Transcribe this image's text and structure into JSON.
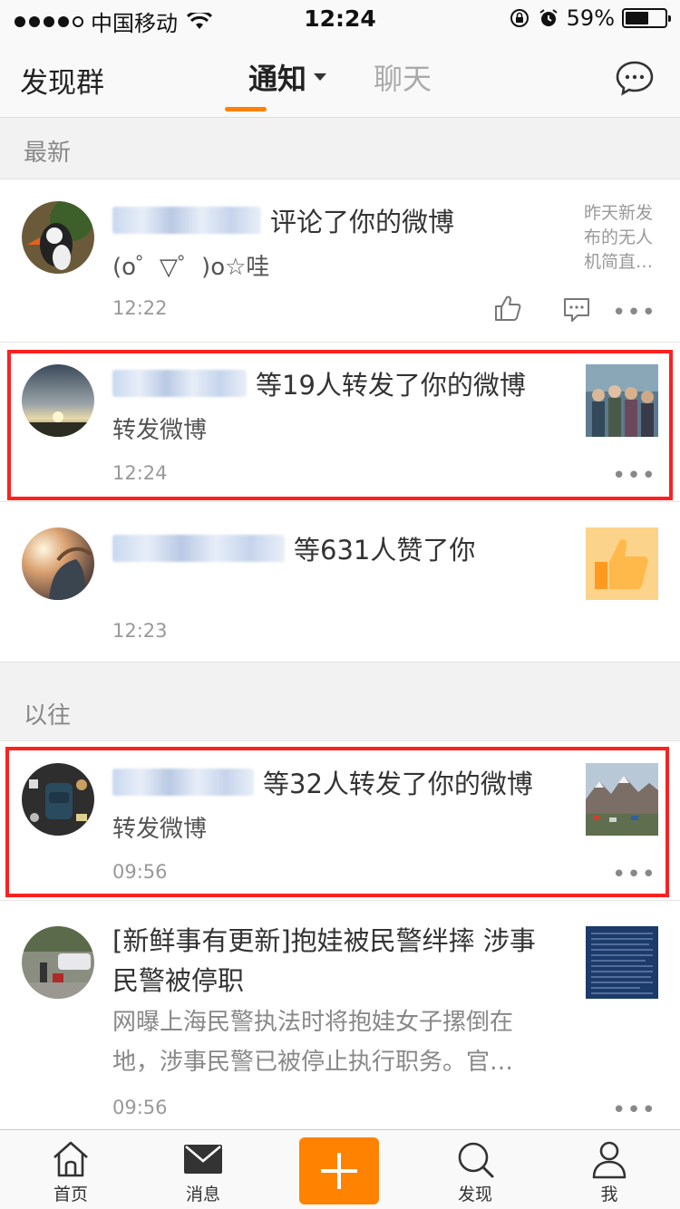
{
  "status_bar": {
    "carrier": "中国移动",
    "time": "12:24",
    "battery": "59%",
    "battery_level": 0.59
  },
  "nav": {
    "left_label": "发现群",
    "tabs": [
      {
        "label": "通知"
      },
      {
        "label": "聊天"
      }
    ],
    "chat_icon": "chat-bubble-icon"
  },
  "sections": {
    "latest": "最新",
    "past": "以往"
  },
  "items": [
    {
      "action": "评论了你的微博",
      "subtitle": "(o゜▽゜)o☆哇",
      "time": "12:22",
      "side_text": "昨天新发布的无人机简直…"
    },
    {
      "action": "等19人转发了你的微博",
      "subtitle": "转发微博",
      "time": "12:24"
    },
    {
      "action": "等631人赞了你",
      "time": "12:23"
    },
    {
      "action": "等32人转发了你的微博",
      "subtitle": "转发微博",
      "time": "09:56"
    },
    {
      "title": "[新鲜事有更新]抱娃被民警绊摔 涉事民警被停职",
      "body": "网曝上海民警执法时将抱娃女子摞倒在地，涉事民警已被停止执行职务。官…",
      "time": "09:56"
    }
  ],
  "more_symbol": "•••",
  "tab_bar": {
    "home": "首页",
    "messages": "消息",
    "discover": "发现",
    "me": "我"
  },
  "colors": {
    "accent": "#ff8200",
    "highlight": "#ff2020"
  }
}
